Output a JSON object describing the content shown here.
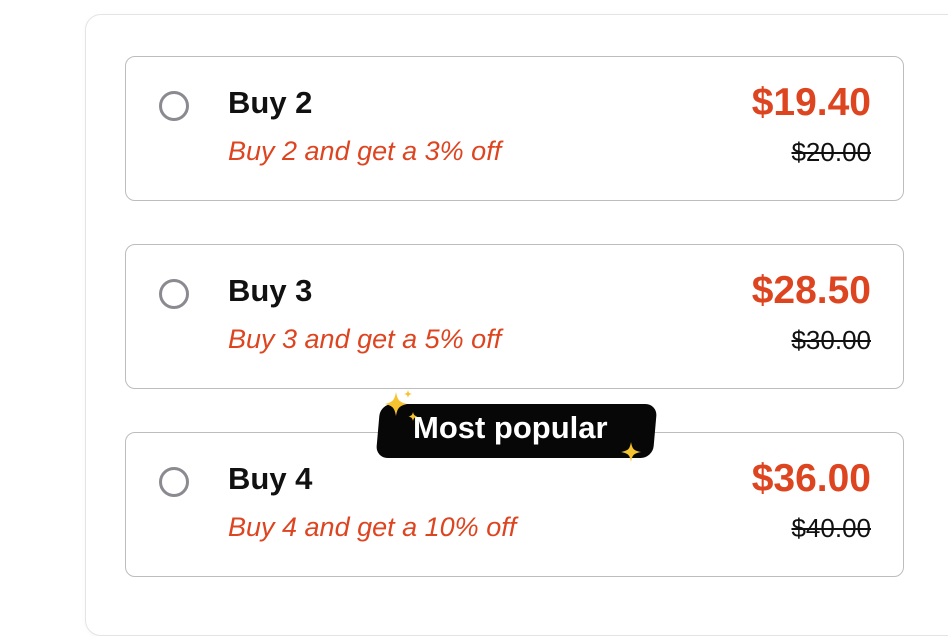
{
  "offers": [
    {
      "title": "Buy 2",
      "subtitle": "Buy 2 and get a 3% off",
      "price": "$19.40",
      "compare_price": "$20.00"
    },
    {
      "title": "Buy 3",
      "subtitle": "Buy 3 and get a 5% off",
      "price": "$28.50",
      "compare_price": "$30.00"
    },
    {
      "title": "Buy 4",
      "subtitle": "Buy 4 and get a 10% off",
      "price": "$36.00",
      "compare_price": "$40.00"
    }
  ],
  "badge": {
    "label": "Most popular",
    "icon": "sparkle-icon"
  },
  "colors": {
    "accent": "#dd4521",
    "badge_bg": "#070707",
    "sparkle": "#f5c230",
    "border": "#bdbdbd"
  }
}
